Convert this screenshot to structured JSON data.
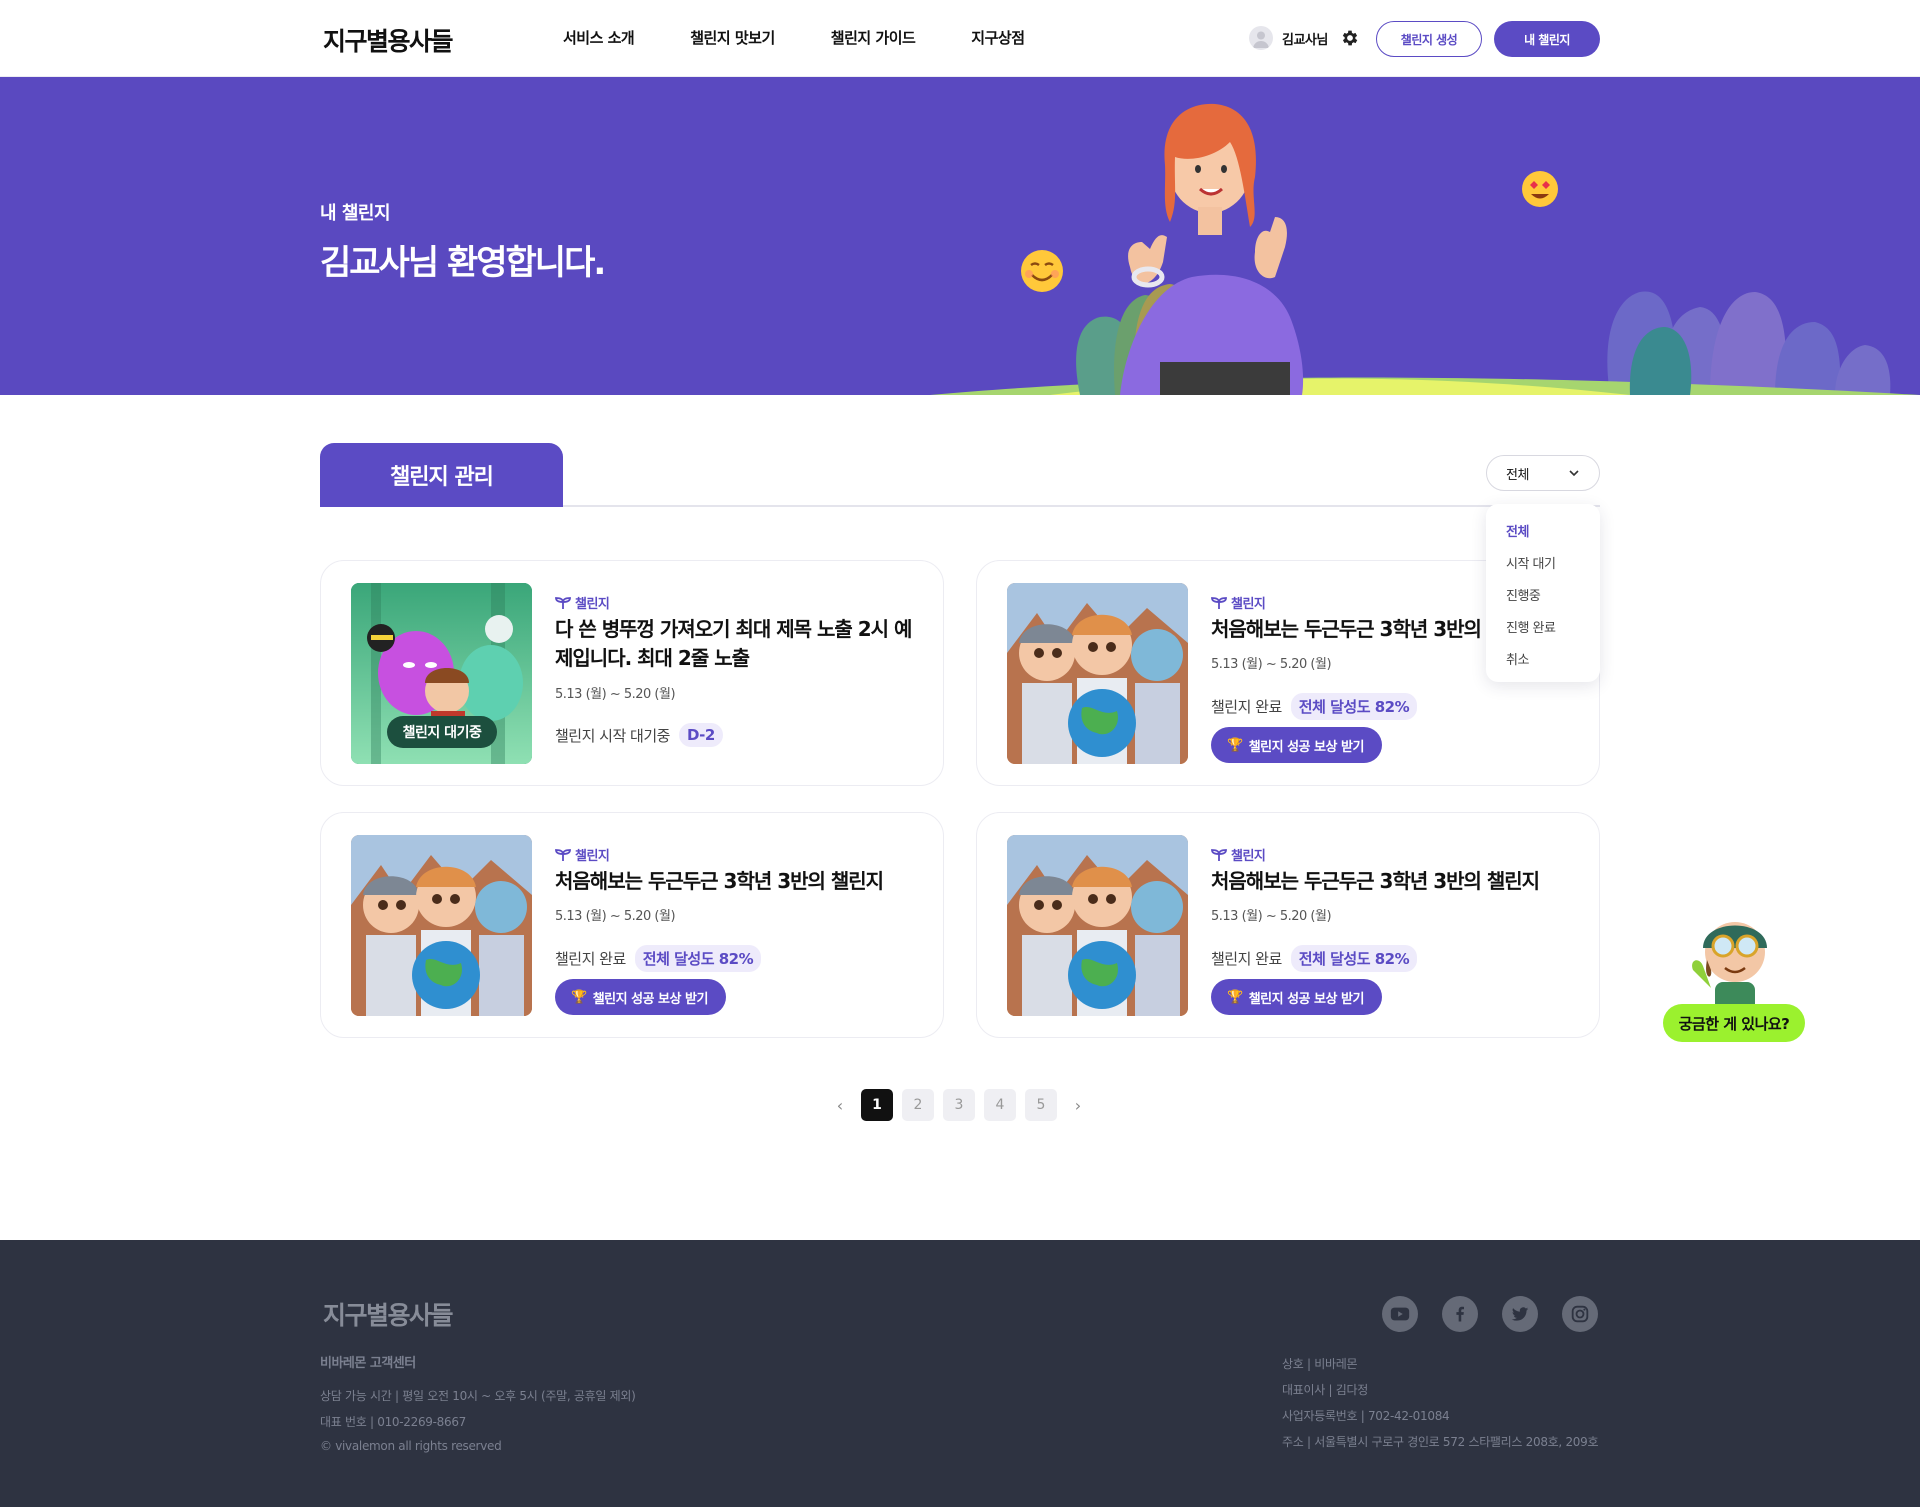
{
  "header": {
    "logo": "지구별용사들",
    "nav": [
      "서비스 소개",
      "챌린지 맛보기",
      "챌린지 가이드",
      "지구상점"
    ],
    "user_name": "김교사님",
    "create_button": "챌린지 생성",
    "my_button": "내 챌린지"
  },
  "hero": {
    "subtitle": "내 챌린지",
    "title": "김교사님 환영합니다."
  },
  "section": {
    "tab": "챌린지 관리",
    "filter_selected": "전체",
    "filter_options": [
      "전체",
      "시작 대기",
      "진행중",
      "진행 완료",
      "취소"
    ]
  },
  "cards": [
    {
      "category": "챌린지",
      "title": "다 쓴 병뚜껑 가져오기 최대 제목 노출 2시 예제입니다. 최대 2줄 노출",
      "date": "5.13 (월) ~ 5.20 (월)",
      "status": "챌린지 시작 대기중",
      "badge": "D-2",
      "thumb_label": "챌린지 대기중"
    },
    {
      "category": "챌린지",
      "title": "처음해보는 두근두근 3학년 3반의 챌린지",
      "date": "5.13 (월) ~ 5.20 (월)",
      "status": "챌린지 완료",
      "badge": "전체 달성도 82%",
      "reward": "챌린지 성공 보상 받기"
    },
    {
      "category": "챌린지",
      "title": "처음해보는 두근두근 3학년 3반의 챌린지",
      "date": "5.13 (월) ~ 5.20 (월)",
      "status": "챌린지 완료",
      "badge": "전체 달성도 82%",
      "reward": "챌린지 성공 보상 받기"
    },
    {
      "category": "챌린지",
      "title": "처음해보는 두근두근 3학년 3반의 챌린지",
      "date": "5.13 (월) ~ 5.20 (월)",
      "status": "챌린지 완료",
      "badge": "전체 달성도 82%",
      "reward": "챌린지 성공 보상 받기"
    }
  ],
  "pagination": {
    "prev": "‹",
    "pages": [
      "1",
      "2",
      "3",
      "4",
      "5"
    ],
    "next": "›",
    "current": "1"
  },
  "fab": {
    "label": "궁금한 게 있나요?"
  },
  "footer": {
    "logo": "지구별용사들",
    "center_title": "비바레몬 고객센터",
    "hours": "상담 가능 시간 | 평일 오전 10시 ~ 오후 5시 (주말, 공휴일 제외)",
    "phone": "대표 번호 | 010-2269-8667",
    "copyright": "© vivalemon all rights reserved",
    "company": "상호 | 비바레몬",
    "ceo": "대표이사 | 김다정",
    "biz_no": "사업자등록번호 | 702-42-01084",
    "address": "주소 | 서울특별시 구로구 경인로 572 스타팰리스 208호, 209호",
    "social": [
      "youtube-icon",
      "facebook-icon",
      "twitter-icon",
      "instagram-icon"
    ]
  },
  "colors": {
    "primary": "#5b4bc4",
    "hero_bg": "#5a49c0",
    "footer_bg": "#2e3341",
    "fab_bg": "#9bf12e"
  }
}
